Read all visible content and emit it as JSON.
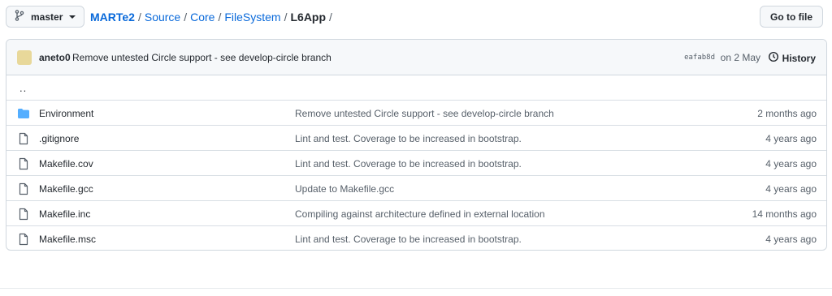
{
  "branch": {
    "name": "master",
    "icon": "git-branch-icon"
  },
  "breadcrumb": {
    "root": "MARTe2",
    "parts": [
      "Source",
      "Core",
      "FileSystem"
    ],
    "current": "L6App",
    "separator": "/"
  },
  "goto_file": "Go to file",
  "commit": {
    "author": "aneto0",
    "message": "Remove untested Circle support - see develop-circle branch",
    "sha": "eafab8d",
    "date": "on 2 May",
    "history_label": "History"
  },
  "parent_dir": "..",
  "files": [
    {
      "type": "dir",
      "name": "Environment",
      "message": "Remove untested Circle support - see develop-circle branch",
      "age": "2 months ago"
    },
    {
      "type": "file",
      "name": ".gitignore",
      "message": "Lint and test. Coverage to be increased in bootstrap.",
      "age": "4 years ago"
    },
    {
      "type": "file",
      "name": "Makefile.cov",
      "message": "Lint and test. Coverage to be increased in bootstrap.",
      "age": "4 years ago"
    },
    {
      "type": "file",
      "name": "Makefile.gcc",
      "message": "Update to Makefile.gcc",
      "age": "4 years ago"
    },
    {
      "type": "file",
      "name": "Makefile.inc",
      "message": "Compiling against architecture defined in external location",
      "age": "14 months ago"
    },
    {
      "type": "file",
      "name": "Makefile.msc",
      "message": "Lint and test. Coverage to be increased in bootstrap.",
      "age": "4 years ago"
    }
  ],
  "colors": {
    "link": "#0969da",
    "folder": "#54aeff",
    "muted": "#57606a"
  }
}
